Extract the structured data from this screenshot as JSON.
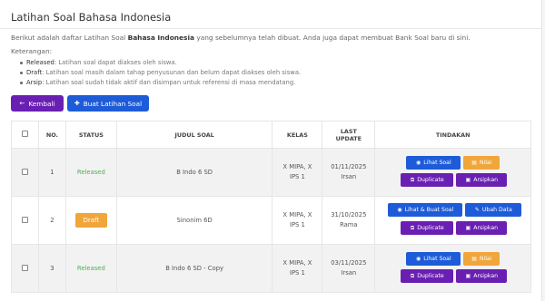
{
  "page": {
    "title": "Latihan Soal Bahasa Indonesia",
    "desc_prefix": "Berikut adalah daftar Latihan Soal ",
    "desc_bold": "Bahasa Indonesia",
    "desc_suffix": " yang sebelumnya telah dibuat. Anda juga dapat membuat Bank Soal baru di sini.",
    "keterangan": "Keterangan:",
    "notes": [
      {
        "term": "Released",
        "text": ": Latihan soal dapat diakses oleh siswa."
      },
      {
        "term": "Draft",
        "text": ": Latihan soal masih dalam tahap penyusunan dan belum dapat diakses oleh siswa."
      },
      {
        "term": "Arsip",
        "text": ": Latihan soal sudah tidak aktif dan disimpan untuk referensi di masa mendatang."
      }
    ]
  },
  "toolbar": {
    "back_label": "Kembali",
    "new_label": "Buat Latihan Soal"
  },
  "table": {
    "headers": {
      "no": "NO.",
      "status": "STATUS",
      "judul": "JUDUL SOAL",
      "kelas": "KELAS",
      "update_l1": "LAST",
      "update_l2": "UPDATE",
      "tindakan": "TINDAKAN"
    },
    "rows": [
      {
        "no": "1",
        "status": "Released",
        "judul": "B Indo 6 SD",
        "kelas_l1": "X MIPA, X",
        "kelas_l2": "IPS 1",
        "date": "01/11/2025",
        "user": "Irsan",
        "btn1": "Lihat Soal",
        "btn2": "Nilai",
        "btn3": "Duplicate",
        "btn4": "Arsipkan"
      },
      {
        "no": "2",
        "status": "Draft",
        "judul": "Sinonim 6D",
        "kelas_l1": "X MIPA, X",
        "kelas_l2": "IPS 1",
        "date": "31/10/2025",
        "user": "Rama",
        "btn1": "Lihat & Buat Soal",
        "btn2": "Ubah Data",
        "btn3": "Duplicate",
        "btn4": "Arsipkan"
      },
      {
        "no": "3",
        "status": "Released",
        "judul": "B Indo 6 SD - Copy",
        "kelas_l1": "X MIPA, X",
        "kelas_l2": "IPS 1",
        "date": "03/11/2025",
        "user": "Irsan",
        "btn1": "Lihat Soal",
        "btn2": "Nilai",
        "btn3": "Duplicate",
        "btn4": "Arsipkan"
      }
    ]
  },
  "colors": {
    "purple": "#6a1fb3",
    "blue": "#1e5bd8",
    "orange": "#f0a63a",
    "released_green": "#4caf50"
  },
  "icons": {
    "back": "arrow-left-icon",
    "new": "plus-icon",
    "view": "eye-icon",
    "grade": "clipboard-icon",
    "edit": "edit-icon",
    "duplicate": "copy-icon",
    "archive": "archive-icon"
  }
}
